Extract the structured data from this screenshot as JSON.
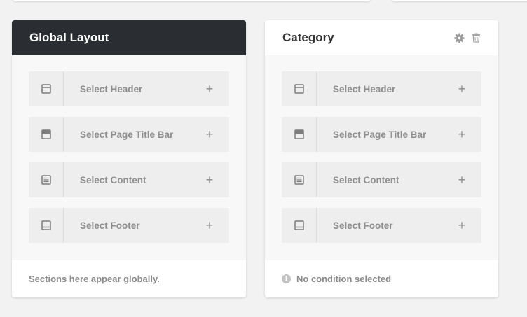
{
  "global_layout": {
    "title": "Global Layout",
    "rows": [
      {
        "label": "Select Header",
        "icon": "header-icon"
      },
      {
        "label": "Select Page Title Bar",
        "icon": "page-title-bar-icon"
      },
      {
        "label": "Select Content",
        "icon": "content-icon"
      },
      {
        "label": "Select Footer",
        "icon": "footer-icon"
      }
    ],
    "footer_text": "Sections here appear globally."
  },
  "category": {
    "title": "Category",
    "actions": [
      "gear-icon",
      "trash-icon"
    ],
    "rows": [
      {
        "label": "Select Header",
        "icon": "header-icon"
      },
      {
        "label": "Select Page Title Bar",
        "icon": "page-title-bar-icon"
      },
      {
        "label": "Select Content",
        "icon": "content-icon"
      },
      {
        "label": "Select Footer",
        "icon": "footer-icon"
      }
    ],
    "footer_text": "No condition selected"
  },
  "plus_symbol": "+",
  "info_symbol": "i",
  "colors": {
    "dark_header": "#2a2e33",
    "background": "#f2f2f2",
    "row_background": "#eeeeee",
    "muted_text": "#8f8f8f"
  }
}
